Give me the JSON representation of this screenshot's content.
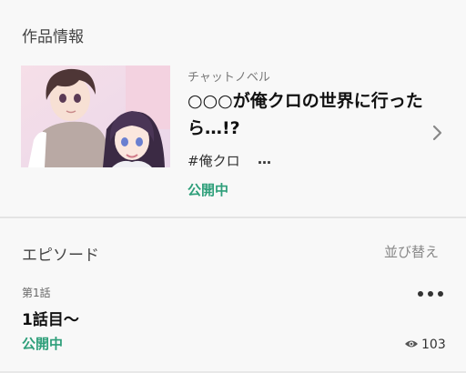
{
  "sections": {
    "work_info_title": "作品情報",
    "episodes_title": "エピソード",
    "sort_label": "並び替え"
  },
  "work": {
    "type": "チャットノベル",
    "title": "○○○が俺クロの世界に行ったら…!?",
    "tag": "#俺クロ",
    "tag_more": "…",
    "status": "公開中"
  },
  "episode": {
    "number": "第1話",
    "title": "1話目〜",
    "status": "公開中",
    "views": "103"
  },
  "colors": {
    "status": "#2e9f7a",
    "background": "#f8f8f8"
  },
  "icons": {
    "chevron": "chevron-right-icon",
    "more": "more-horizontal-icon",
    "views": "eye-icon"
  }
}
